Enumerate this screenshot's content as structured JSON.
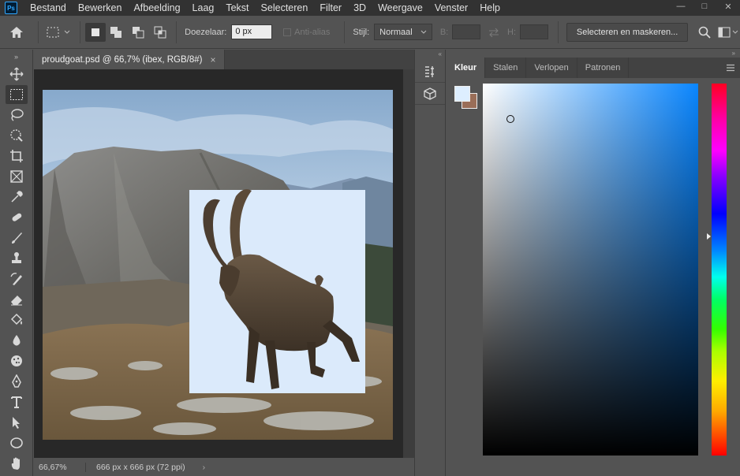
{
  "app": {
    "logo_text": "Ps"
  },
  "menu": [
    "Bestand",
    "Bewerken",
    "Afbeelding",
    "Laag",
    "Tekst",
    "Selecteren",
    "Filter",
    "3D",
    "Weergave",
    "Venster",
    "Help"
  ],
  "window_controls": {
    "minimize": "—",
    "maximize": "□",
    "close": "✕"
  },
  "options_bar": {
    "feather_label": "Doezelaar:",
    "feather_value": "0 px",
    "antialias_label": "Anti-alias",
    "style_label": "Stijl:",
    "style_value": "Normaal",
    "width_label": "B:",
    "height_label": "H:",
    "select_mask_label": "Selecteren en maskeren..."
  },
  "document": {
    "tab_title": "proudgoat.psd @ 66,7% (ibex, RGB/8#)",
    "close_symbol": "×",
    "zoom": "66,67%",
    "size_info": "666 px x 666 px (72 ppi)",
    "status_arrow": "›"
  },
  "tools": [
    "move-tool",
    "marquee-tool",
    "lasso-tool",
    "quick-select-tool",
    "crop-tool",
    "frame-tool",
    "eyedropper-tool",
    "healing-tool",
    "brush-tool",
    "clone-stamp-tool",
    "history-brush-tool",
    "eraser-tool",
    "paint-bucket-tool",
    "blur-tool",
    "dodge-tool",
    "pen-tool",
    "type-tool",
    "path-select-tool",
    "ellipse-tool",
    "hand-tool"
  ],
  "color_panel": {
    "tabs": [
      "Kleur",
      "Stalen",
      "Verlopen",
      "Patronen"
    ],
    "active_tab": "Kleur",
    "foreground_color": "#ddeeff",
    "background_color": "#9a6e58"
  },
  "colors": {
    "accent": "#31a8ff",
    "ui_dark": "#323232",
    "ui_mid": "#535353"
  }
}
